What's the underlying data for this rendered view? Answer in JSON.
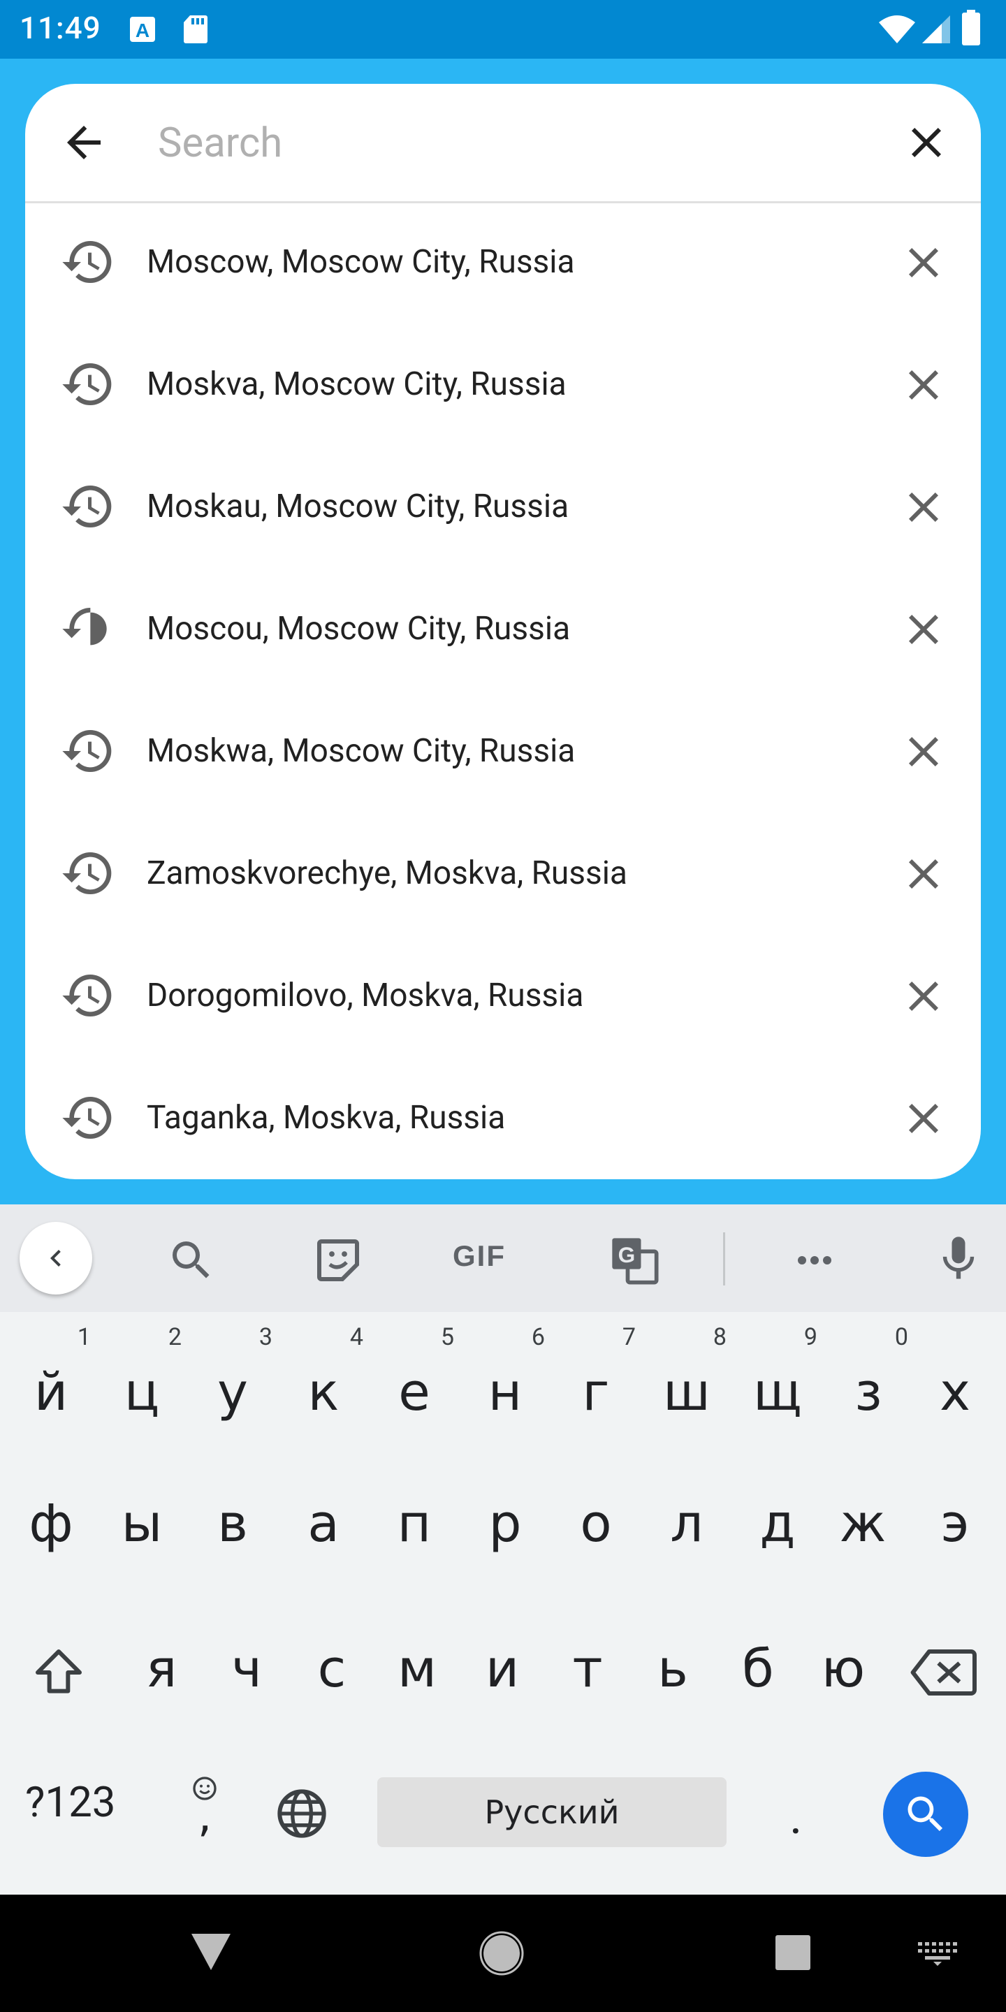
{
  "status_bar": {
    "time": "11:49"
  },
  "search": {
    "placeholder": "Search",
    "value": ""
  },
  "history": [
    {
      "label": "Moscow, Moscow City, Russia"
    },
    {
      "label": "Moskva, Moscow City, Russia"
    },
    {
      "label": "Moskau, Moscow City, Russia"
    },
    {
      "label": "Moscou, Moscow City, Russia"
    },
    {
      "label": "Moskwa, Moscow City, Russia"
    },
    {
      "label": "Zamoskvorechye, Moskva, Russia"
    },
    {
      "label": "Dorogomilovo, Moskva, Russia"
    },
    {
      "label": "Taganka, Moskva, Russia"
    }
  ],
  "keyboard": {
    "toolbar": {
      "gif_label": "GIF"
    },
    "row1": [
      {
        "ch": "й",
        "hint": "1"
      },
      {
        "ch": "ц",
        "hint": "2"
      },
      {
        "ch": "у",
        "hint": "3"
      },
      {
        "ch": "к",
        "hint": "4"
      },
      {
        "ch": "е",
        "hint": "5"
      },
      {
        "ch": "н",
        "hint": "6"
      },
      {
        "ch": "г",
        "hint": "7"
      },
      {
        "ch": "ш",
        "hint": "8"
      },
      {
        "ch": "щ",
        "hint": "9"
      },
      {
        "ch": "з",
        "hint": "0"
      },
      {
        "ch": "х",
        "hint": ""
      }
    ],
    "row2": [
      "ф",
      "ы",
      "в",
      "а",
      "п",
      "р",
      "о",
      "л",
      "д",
      "ж",
      "э"
    ],
    "row3": [
      "я",
      "ч",
      "с",
      "м",
      "и",
      "т",
      "ь",
      "б",
      "ю"
    ],
    "symbols_label": "?123",
    "comma": ",",
    "space_label": "Русский",
    "period": ".",
    "accent_color": "#1a73e8"
  },
  "colors": {
    "app_background": "#2bb6f4",
    "status_bar": "#0288d1"
  }
}
